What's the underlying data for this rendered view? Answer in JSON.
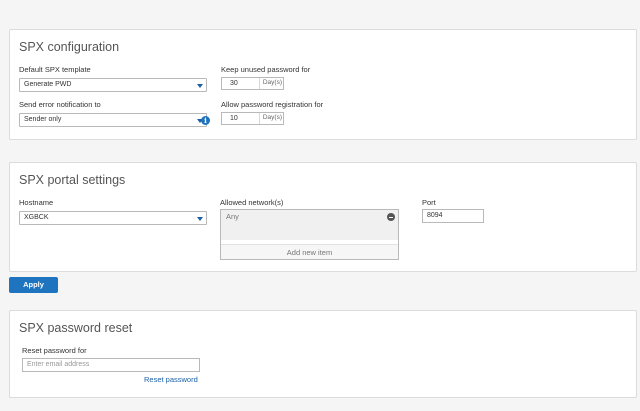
{
  "spx_configuration": {
    "title": "SPX configuration",
    "default_template_label": "Default SPX template",
    "default_template_value": "Generate PWD",
    "error_notification_label": "Send error notification to",
    "error_notification_value": "Sender only",
    "keep_unused_label": "Keep unused password for",
    "keep_unused_value": "30",
    "keep_unused_unit": "Day(s)",
    "allow_registration_label": "Allow password registration for",
    "allow_registration_value": "10",
    "allow_registration_unit": "Day(s)",
    "info_icon": "info-icon",
    "info_glyph": "i"
  },
  "spx_portal_settings": {
    "title": "SPX portal settings",
    "hostname_label": "Hostname",
    "hostname_value": "XGBCK",
    "allowed_networks_label": "Allowed network(s)",
    "allowed_networks_items": [
      "Any"
    ],
    "add_new_item_label": "Add new item",
    "port_label": "Port",
    "port_value": "8094"
  },
  "apply_button_label": "Apply",
  "spx_password_reset": {
    "title": "SPX password reset",
    "reset_label": "Reset password for",
    "email_placeholder": "Enter email address",
    "reset_link_label": "Reset password"
  },
  "colors": {
    "accent": "#1f74c0",
    "link": "#1a5fa8",
    "background": "#f5f5f5",
    "panel": "#ffffff"
  }
}
